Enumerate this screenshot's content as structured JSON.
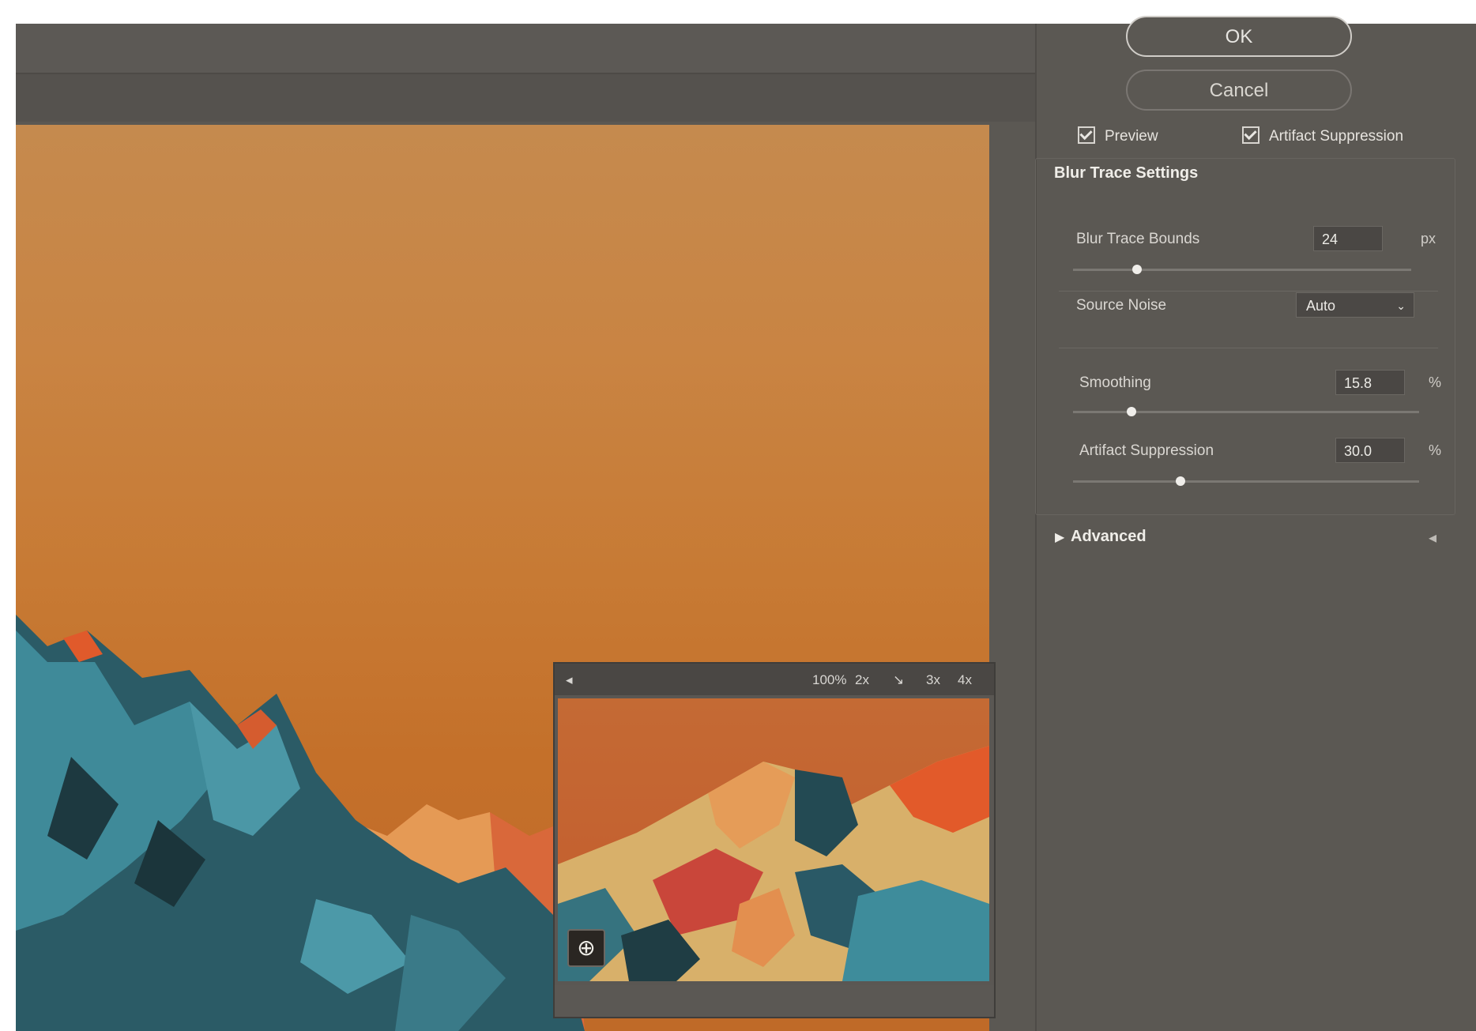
{
  "dialog": {
    "ok_label": "OK",
    "cancel_label": "Cancel",
    "preview_label": "Preview",
    "artifact_checkbox_label": "Artifact Suppression",
    "section_title": "Blur Trace Settings",
    "blur_trace_bounds": {
      "label": "Blur Trace Bounds",
      "value": "24",
      "unit": "px",
      "slider_fraction": 0.19
    },
    "source_noise": {
      "label": "Source Noise",
      "value": "Auto"
    },
    "smoothing": {
      "label": "Smoothing",
      "value": "15.8",
      "unit": "%",
      "slider_fraction": 0.17
    },
    "artifact_suppression": {
      "label": "Artifact Suppression",
      "value": "30.0",
      "unit": "%",
      "slider_fraction": 0.31
    },
    "advanced_label": "Advanced"
  },
  "loupe": {
    "zoom": "100%",
    "btn_2x": "2x",
    "btn_3x": "3x",
    "btn_4x": "4x"
  }
}
